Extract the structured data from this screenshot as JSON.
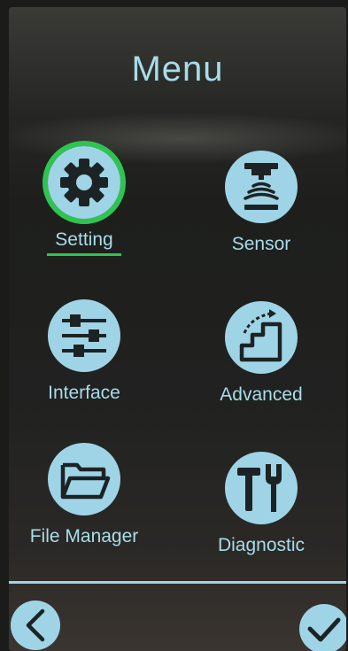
{
  "title": "Menu",
  "menu": {
    "items": [
      {
        "label": "Setting",
        "icon": "gear-icon",
        "selected": true
      },
      {
        "label": "Sensor",
        "icon": "sensor-icon",
        "selected": false
      },
      {
        "label": "Interface",
        "icon": "sliders-icon",
        "selected": false
      },
      {
        "label": "Advanced",
        "icon": "stairs-icon",
        "selected": false
      },
      {
        "label": "File Manager",
        "icon": "folder-icon",
        "selected": false
      },
      {
        "label": "Diagnostic",
        "icon": "tools-icon",
        "selected": false
      }
    ]
  },
  "nav": {
    "back_icon": "chevron-left-icon",
    "confirm_icon": "checkmark-icon"
  },
  "colors": {
    "accent": "#9fd4e6",
    "selected": "#2fc451",
    "icon_glyph": "#1d2324"
  }
}
